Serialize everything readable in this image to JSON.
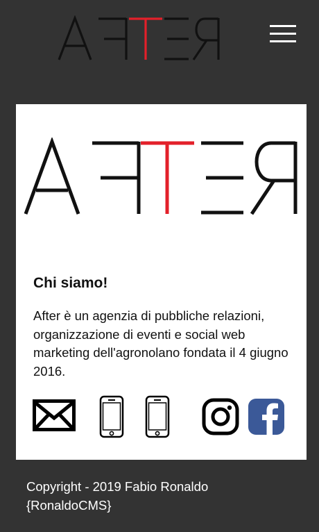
{
  "brand": {
    "logo_text": "AFTER",
    "accent_color": "#e3202a",
    "ink_color": "#111111"
  },
  "header": {
    "menu_icon": "hamburger-menu-icon"
  },
  "about": {
    "title": "Chi siamo!",
    "description": "After è un agenzia di pubbliche relazioni, organizzazione di eventi e social web marketing dell'agronolano fondata il 4 giugno 2016."
  },
  "contacts": [
    {
      "icon": "mail-icon"
    },
    {
      "icon": "phone-icon"
    },
    {
      "icon": "phone-icon"
    },
    {
      "icon": "instagram-icon"
    },
    {
      "icon": "facebook-icon",
      "color": "#3b5998"
    }
  ],
  "footer": {
    "line1": "Copyright - 2019 Fabio Ronaldo",
    "line2": "{RonaldoCMS}"
  }
}
